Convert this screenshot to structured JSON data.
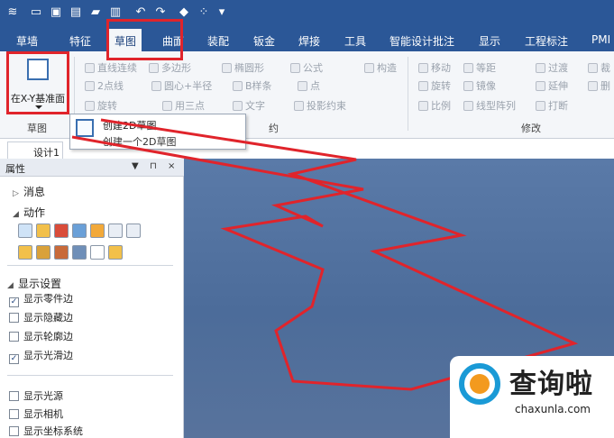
{
  "quick_access": {
    "icons": [
      "app-menu-icon",
      "new-file-icon",
      "open-file-icon",
      "save-icon",
      "folder-icon",
      "print-icon",
      "undo-icon",
      "redo-icon",
      "shape-icon",
      "dot-grid-icon",
      "dropdown-icon"
    ]
  },
  "menu": {
    "tabs": [
      {
        "label": "草墙",
        "active": false
      },
      {
        "label": "特征",
        "active": false
      },
      {
        "label": "草图",
        "active": true
      },
      {
        "label": "曲面",
        "active": false
      },
      {
        "label": "装配",
        "active": false
      },
      {
        "label": "钣金",
        "active": false
      },
      {
        "label": "焊接",
        "active": false
      },
      {
        "label": "工具",
        "active": false
      },
      {
        "label": "智能设计批注",
        "active": false
      },
      {
        "label": "显示",
        "active": false
      },
      {
        "label": "工程标注",
        "active": false
      },
      {
        "label": "PMI",
        "active": false
      }
    ]
  },
  "ribbon": {
    "big_button": {
      "label": "在X-Y基准面"
    },
    "group_sketch": "草图",
    "group_modify": "修改",
    "draw_tools": {
      "row1": [
        "直线连续",
        "多边形",
        "椭圆形",
        "公式"
      ],
      "row2": [
        "2点线",
        "圆心+半径",
        "B样条",
        "点"
      ],
      "row3": [
        "旋转",
        "用三点",
        "文字",
        "投影约束"
      ],
      "constraint": "构造"
    },
    "modify_tools": {
      "row1": [
        "移动",
        "等距",
        "过渡",
        "裁"
      ],
      "row2": [
        "旋转",
        "镜像",
        "延伸",
        "删"
      ],
      "row3": [
        "比例",
        "线型阵列",
        "打断"
      ]
    },
    "group_partial": "约"
  },
  "tooltip": {
    "title": "创建2D草图",
    "description": "创建一个2D草图"
  },
  "document_tab": {
    "label": "设计1"
  },
  "panel": {
    "title": "属性",
    "buttons": [
      "▼",
      "⊓",
      "×"
    ],
    "sections": {
      "message": "消息",
      "action": "动作",
      "display_settings": "显示设置"
    },
    "options": [
      {
        "label": "显示零件边",
        "checked": true
      },
      {
        "label": "显示隐藏边",
        "checked": false
      },
      {
        "label": "显示轮廓边",
        "checked": false
      },
      {
        "label": "显示光滑边",
        "checked": true
      }
    ],
    "options2": [
      {
        "label": "显示光源",
        "checked": false
      },
      {
        "label": "显示相机",
        "checked": false
      },
      {
        "label": "显示坐标系统",
        "checked": false
      }
    ]
  },
  "watermark": {
    "brand": "查询啦",
    "url": "chaxunla.com"
  },
  "colors": {
    "titlebar": "#2b5797",
    "annotation_red": "#e0242b",
    "viewport": "#5a7aa8"
  }
}
